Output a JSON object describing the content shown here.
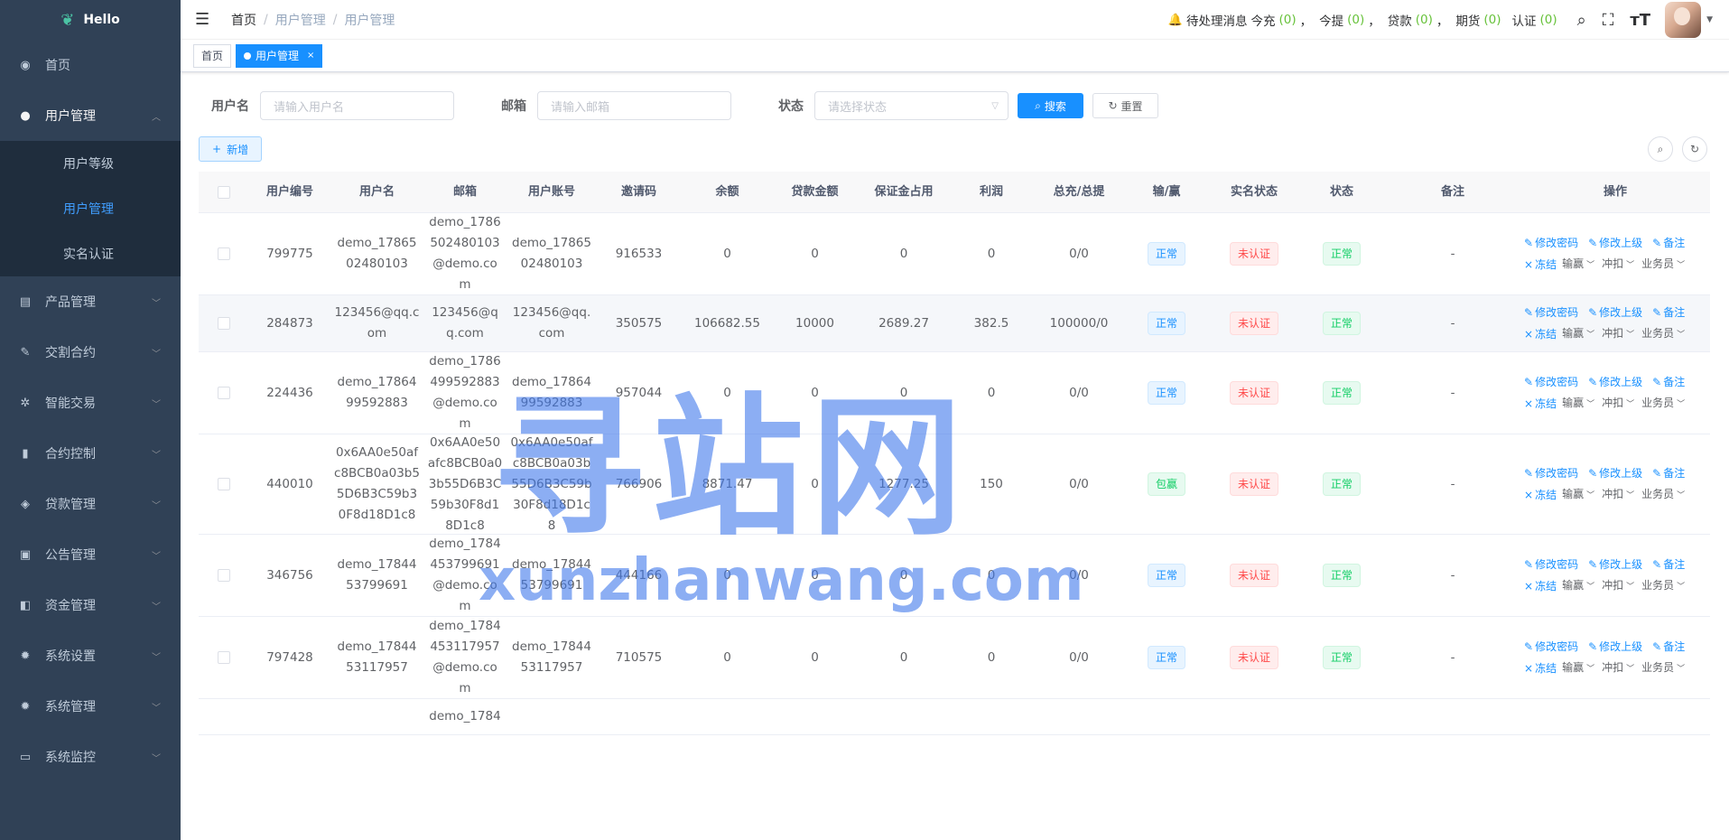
{
  "app": {
    "logo_text": "Hello"
  },
  "sidebar": {
    "items": [
      {
        "label": "首页",
        "icon": "dashboard-icon",
        "glyph": "◉",
        "has_children": false,
        "open": false
      },
      {
        "label": "用户管理",
        "icon": "user-icon",
        "glyph": "●",
        "has_children": true,
        "open": true,
        "children": [
          {
            "label": "用户等级",
            "active": false
          },
          {
            "label": "用户管理",
            "active": true
          },
          {
            "label": "实名认证",
            "active": false
          }
        ]
      },
      {
        "label": "产品管理",
        "icon": "document-icon",
        "glyph": "▤",
        "has_children": true,
        "open": false
      },
      {
        "label": "交割合约",
        "icon": "edit-icon",
        "glyph": "✎",
        "has_children": true,
        "open": false
      },
      {
        "label": "智能交易",
        "icon": "gear-small-icon",
        "glyph": "✲",
        "has_children": true,
        "open": false
      },
      {
        "label": "合约控制",
        "icon": "bar-chart-icon",
        "glyph": "▮",
        "has_children": true,
        "open": false
      },
      {
        "label": "贷款管理",
        "icon": "money-icon",
        "glyph": "◈",
        "has_children": true,
        "open": false
      },
      {
        "label": "公告管理",
        "icon": "message-icon",
        "glyph": "▣",
        "has_children": true,
        "open": false
      },
      {
        "label": "资金管理",
        "icon": "fund-icon",
        "glyph": "◧",
        "has_children": true,
        "open": false
      },
      {
        "label": "系统设置",
        "icon": "settings-icon",
        "glyph": "✹",
        "has_children": true,
        "open": false
      },
      {
        "label": "系统管理",
        "icon": "system-icon",
        "glyph": "✹",
        "has_children": true,
        "open": false
      },
      {
        "label": "系统监控",
        "icon": "monitor-icon",
        "glyph": "▭",
        "has_children": true,
        "open": false
      }
    ]
  },
  "header": {
    "breadcrumb": [
      "首页",
      "用户管理",
      "用户管理"
    ],
    "notice": {
      "label": "待处理消息",
      "items": [
        {
          "label": "今充",
          "count": "(0)",
          "sep": "，"
        },
        {
          "label": "今提",
          "count": "(0)",
          "sep": "，"
        },
        {
          "label": "贷款",
          "count": "(0)",
          "sep": "，"
        },
        {
          "label": "期货",
          "count": "(0)",
          "sep": ""
        },
        {
          "label": "认证",
          "count": "(0)",
          "sep": ""
        }
      ]
    }
  },
  "tags": {
    "home": "首页",
    "active": "用户管理",
    "close": "×"
  },
  "search": {
    "username_label": "用户名",
    "username_placeholder": "请输入用户名",
    "email_label": "邮箱",
    "email_placeholder": "请输入邮箱",
    "status_label": "状态",
    "status_placeholder": "请选择状态",
    "search_button": "搜索",
    "reset_button": "重置"
  },
  "toolbar": {
    "add_button": "新增"
  },
  "table": {
    "columns": [
      "用户编号",
      "用户名",
      "邮箱",
      "用户账号",
      "邀请码",
      "余额",
      "贷款金额",
      "保证金占用",
      "利润",
      "总充/总提",
      "输/赢",
      "实名状态",
      "状态",
      "备注",
      "操作"
    ],
    "ops": {
      "edit_password": "修改密码",
      "edit_parent": "修改上级",
      "note": "备注",
      "freeze": "冻结",
      "winlose": "输赢",
      "offset": "冲扣",
      "salesman": "业务员"
    },
    "rows": [
      {
        "id": "799775",
        "username": "demo_1786502480103",
        "email": "demo_1786502480103@demo.com",
        "account": "demo_1786502480103",
        "invite": "916533",
        "balance": "0",
        "loan": "0",
        "margin": "0",
        "profit": "0",
        "total": "0/0",
        "winlose": "正常",
        "winlose_type": "blue",
        "realname": "未认证",
        "status": "正常",
        "note": "-"
      },
      {
        "id": "284873",
        "username": "123456@qq.com",
        "email": "123456@qq.com",
        "account": "123456@qq.com",
        "invite": "350575",
        "balance": "106682.55",
        "loan": "10000",
        "margin": "2689.27",
        "profit": "382.5",
        "total": "100000/0",
        "winlose": "正常",
        "winlose_type": "blue",
        "realname": "未认证",
        "status": "正常",
        "note": "-"
      },
      {
        "id": "224436",
        "username": "demo_1786499592883",
        "email": "demo_1786499592883@demo.com",
        "account": "demo_1786499592883",
        "invite": "957044",
        "balance": "0",
        "loan": "0",
        "margin": "0",
        "profit": "0",
        "total": "0/0",
        "winlose": "正常",
        "winlose_type": "blue",
        "realname": "未认证",
        "status": "正常",
        "note": "-"
      },
      {
        "id": "440010",
        "username": "0x6AA0e50afc8BCB0a03b55D6B3C59b30F8d18D1c8",
        "email": "0x6AA0e50afc8BCB0a03b55D6B3C59b30F8d18D1c8",
        "account": "0x6AA0e50afc8BCB0a03b55D6B3C59b30F8d18D1c8",
        "invite": "766906",
        "balance": "8871.47",
        "loan": "0",
        "margin": "1277.25",
        "profit": "150",
        "total": "0/0",
        "winlose": "包赢",
        "winlose_type": "green",
        "realname": "未认证",
        "status": "正常",
        "note": "-"
      },
      {
        "id": "346756",
        "username": "demo_1784453799691",
        "email": "demo_1784453799691@demo.com",
        "account": "demo_1784453799691",
        "invite": "444166",
        "balance": "0",
        "loan": "0",
        "margin": "0",
        "profit": "0",
        "total": "0/0",
        "winlose": "正常",
        "winlose_type": "blue",
        "realname": "未认证",
        "status": "正常",
        "note": "-"
      },
      {
        "id": "797428",
        "username": "demo_1784453117957",
        "email": "demo_1784453117957@demo.com",
        "account": "demo_1784453117957",
        "invite": "710575",
        "balance": "0",
        "loan": "0",
        "margin": "0",
        "profit": "0",
        "total": "0/0",
        "winlose": "正常",
        "winlose_type": "blue",
        "realname": "未认证",
        "status": "正常",
        "note": "-"
      }
    ],
    "partial_row_email": "demo_1784"
  },
  "watermark": {
    "cn": "寻站网",
    "en": "xunzhanwang.com"
  }
}
